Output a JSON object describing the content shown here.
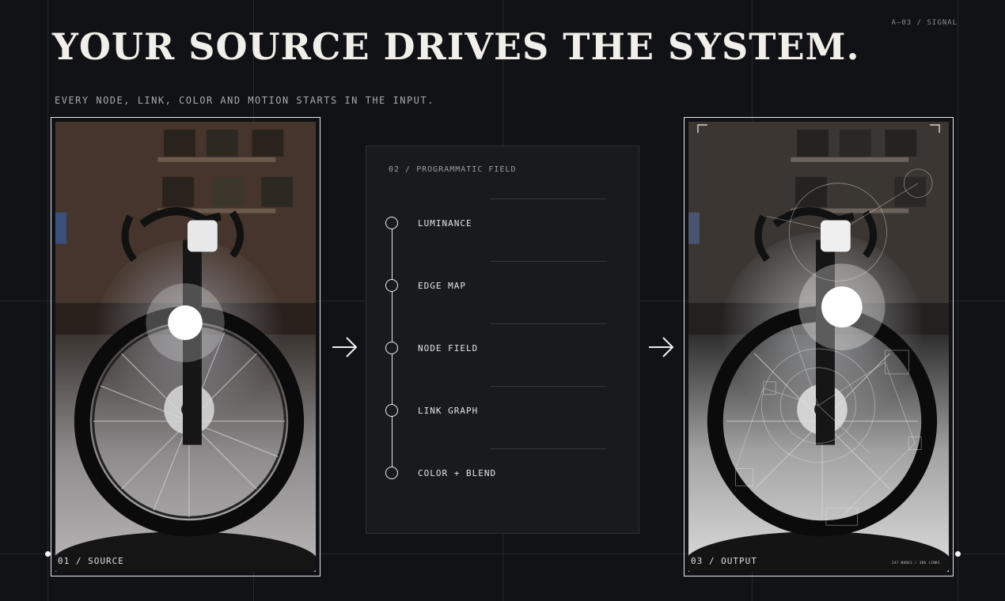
{
  "corner_tag": "A—03 / SIGNAL",
  "title": "YOUR SOURCE DRIVES THE SYSTEM.",
  "subtitle": "EVERY NODE, LINK, COLOR AND MOTION STARTS IN THE INPUT.",
  "source": {
    "label": "01 / SOURCE"
  },
  "panel": {
    "title": "02 / PROGRAMMATIC FIELD",
    "steps": [
      "LUMINANCE",
      "EDGE MAP",
      "NODE FIELD",
      "LINK GRAPH",
      "COLOR + BLEND"
    ]
  },
  "output": {
    "label": "03 / OUTPUT",
    "stats": "247 NODES / 386 LINKS"
  },
  "colors": {
    "background": "#111215",
    "panel": "#181b1e",
    "frame": "#e9e9e9",
    "text": "#f1efea"
  }
}
